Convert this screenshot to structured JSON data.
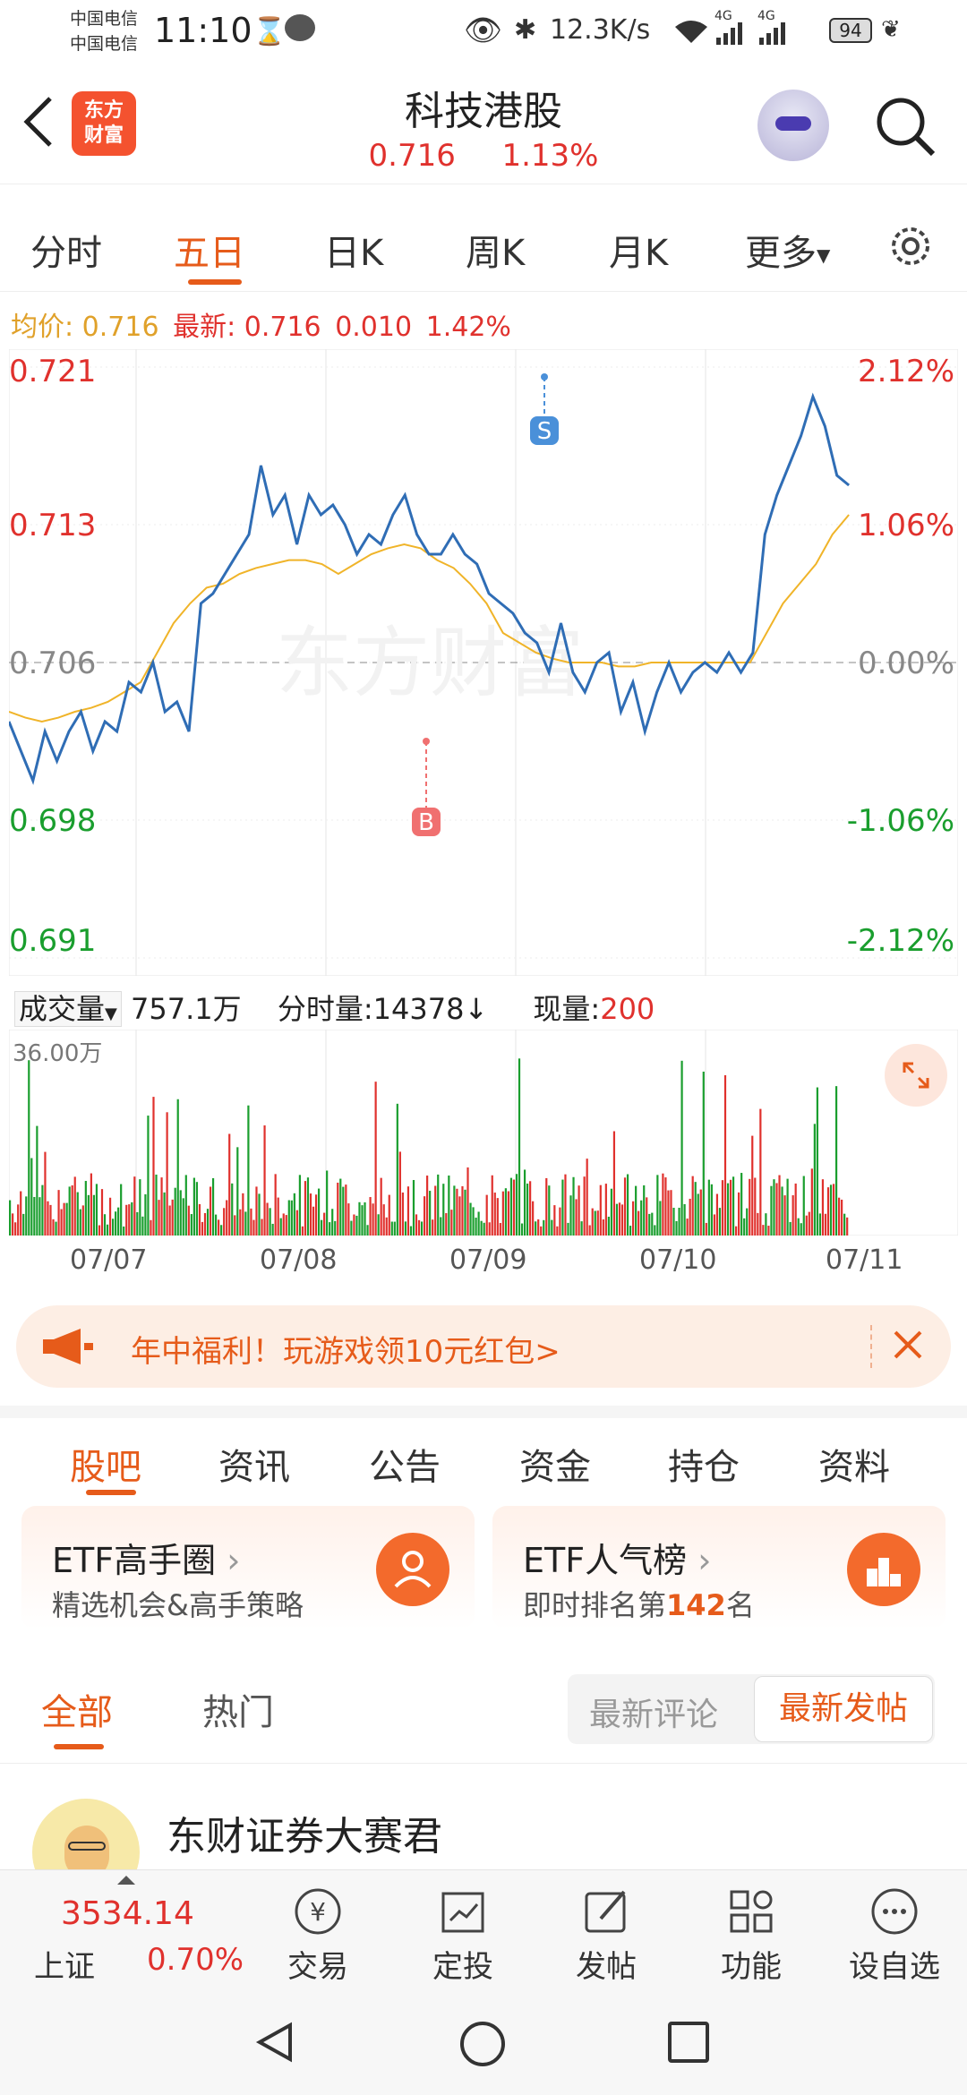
{
  "status_bar": {
    "carrier1": "中国电信",
    "carrier2": "中国电信",
    "time": "11:10",
    "net_speed": "12.3K/s",
    "signal1": "4G",
    "signal2": "4G",
    "battery": "94"
  },
  "header": {
    "logo_line1": "东方",
    "logo_line2": "财富",
    "title": "科技港股",
    "price": "0.716",
    "change_pct": "1.13%"
  },
  "tabs": [
    {
      "label": "分时",
      "active": false
    },
    {
      "label": "五日",
      "active": true
    },
    {
      "label": "日K",
      "active": false
    },
    {
      "label": "周K",
      "active": false
    },
    {
      "label": "月K",
      "active": false
    },
    {
      "label": "更多",
      "active": false
    }
  ],
  "info_line": {
    "avg_label": "均价:",
    "avg_value": "0.716",
    "latest_label": "最新:",
    "latest_value": "0.716",
    "change_abs": "0.010",
    "change_pct": "1.42%"
  },
  "chart_data": {
    "type": "line",
    "x": [
      "07/07",
      "07/08",
      "07/09",
      "07/10",
      "07/11"
    ],
    "y_left_ticks": [
      "0.721",
      "0.713",
      "0.706",
      "0.698",
      "0.691"
    ],
    "y_right_ticks": [
      "2.12%",
      "1.06%",
      "0.00%",
      "-1.06%",
      "-2.12%"
    ],
    "ylim": [
      0.691,
      0.721
    ],
    "baseline": 0.706,
    "watermark": "东方财富",
    "markers": [
      {
        "label": "B",
        "x": "07/10",
        "value": 0.702
      },
      {
        "label": "S",
        "x": "07/11",
        "value": 0.7205
      }
    ],
    "series": [
      {
        "values": [
          0.703,
          0.7015,
          0.7,
          0.7025,
          0.701,
          0.7025,
          0.7035,
          0.7015,
          0.703,
          0.7025,
          0.705,
          0.7045,
          0.706,
          0.7035,
          0.704,
          0.7025,
          0.709,
          0.7095,
          0.7105,
          0.7115,
          0.7125,
          0.716,
          0.7135,
          0.7145,
          0.712,
          0.7145,
          0.7135,
          0.714,
          0.713,
          0.7115,
          0.7125,
          0.712,
          0.7135,
          0.7145,
          0.7125,
          0.7115,
          0.7115,
          0.7125,
          0.7115,
          0.711,
          0.7095,
          0.709,
          0.7085,
          0.7075,
          0.707,
          0.7055,
          0.708,
          0.7055,
          0.7045,
          0.706,
          0.7065,
          0.7035,
          0.705,
          0.7025,
          0.7045,
          0.706,
          0.7045,
          0.7055,
          0.706,
          0.7055,
          0.7065,
          0.7055,
          0.7065,
          0.7125,
          0.7145,
          0.716,
          0.7175,
          0.7195,
          0.718,
          0.7155,
          0.715
        ]
      },
      {
        "values": [
          0.7035,
          0.7032,
          0.703,
          0.7032,
          0.7035,
          0.7037,
          0.704,
          0.7045,
          0.705,
          0.7065,
          0.708,
          0.709,
          0.7098,
          0.71,
          0.7105,
          0.7108,
          0.711,
          0.7112,
          0.7112,
          0.711,
          0.7105,
          0.711,
          0.7115,
          0.7118,
          0.712,
          0.7118,
          0.7112,
          0.7108,
          0.71,
          0.709,
          0.7075,
          0.707,
          0.7065,
          0.7062,
          0.706,
          0.706,
          0.706,
          0.7058,
          0.7058,
          0.706,
          0.706,
          0.706,
          0.706,
          0.706,
          0.706,
          0.706,
          0.7075,
          0.709,
          0.71,
          0.711,
          0.7125,
          0.7135
        ]
      }
    ]
  },
  "volume": {
    "label": "成交量",
    "total": "757.1万",
    "period_label": "分时量:",
    "period_value": "14378",
    "arrow": "↓",
    "current_label": "现量:",
    "current_value": "200",
    "max_label": "36.00万"
  },
  "banner": {
    "text": "年中福利！玩游戏领10元红包>"
  },
  "section_tabs": [
    "股吧",
    "资讯",
    "公告",
    "资金",
    "持仓",
    "资料"
  ],
  "cards": [
    {
      "title": "ETF高手圈",
      "subtitle": "精选机会&高手策略"
    },
    {
      "title": "ETF人气榜",
      "subtitle_prefix": "即时排名第",
      "rank": "142",
      "subtitle_suffix": "名"
    }
  ],
  "sub_tabs": {
    "all": "全部",
    "hot": "热门",
    "latest_comment": "最新评论",
    "latest_post": "最新发帖"
  },
  "post": {
    "author": "东财证券大赛君"
  },
  "bottom_nav": {
    "index_value": "3534.14",
    "index_name": "上证",
    "index_change": "0.70%",
    "items": [
      "交易",
      "定投",
      "发帖",
      "功能",
      "设自选"
    ]
  },
  "colors": {
    "accent": "#e65b1a",
    "up": "#e0312d",
    "down": "#1a9e2e",
    "price_line": "#2f6db5",
    "avg_line": "#f0b429"
  }
}
